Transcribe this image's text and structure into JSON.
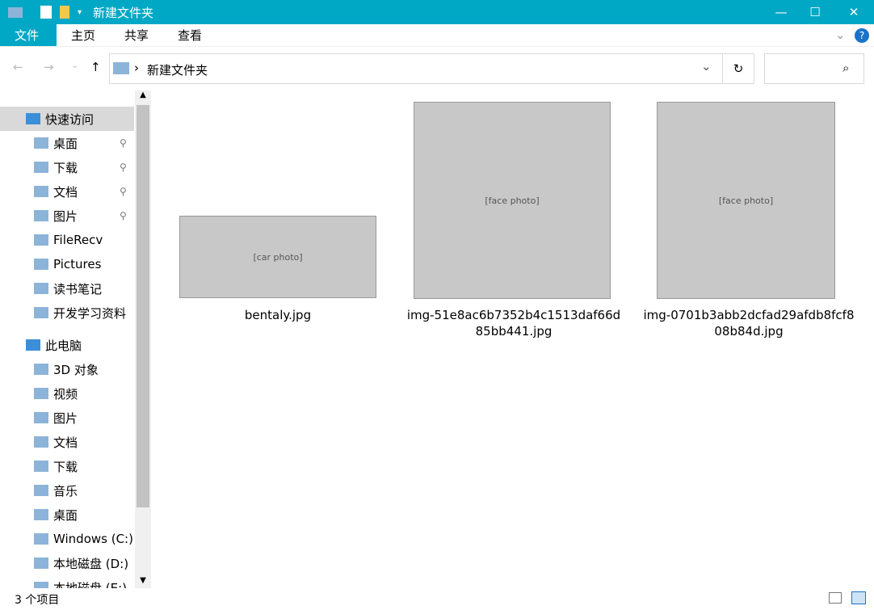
{
  "window": {
    "title": "新建文件夹",
    "minimize": "—",
    "maximize": "☐",
    "close": "✕"
  },
  "ribbon": {
    "tabs": [
      "文件",
      "主页",
      "共享",
      "查看"
    ],
    "help": "?"
  },
  "address": {
    "path": "新建文件夹",
    "sep": "›",
    "refresh": "↻"
  },
  "sidebar": [
    {
      "label": "快速访问",
      "indent": 0,
      "sel": true
    },
    {
      "label": "桌面",
      "indent": 1,
      "pin": true
    },
    {
      "label": "下载",
      "indent": 1,
      "pin": true
    },
    {
      "label": "文档",
      "indent": 1,
      "pin": true
    },
    {
      "label": "图片",
      "indent": 1,
      "pin": true
    },
    {
      "label": "FileRecv",
      "indent": 1
    },
    {
      "label": "Pictures",
      "indent": 1
    },
    {
      "label": "读书笔记",
      "indent": 1
    },
    {
      "label": "开发学习资料",
      "indent": 1
    },
    {
      "label": "此电脑",
      "indent": 0,
      "gap": true
    },
    {
      "label": "3D 对象",
      "indent": 1
    },
    {
      "label": "视频",
      "indent": 1
    },
    {
      "label": "图片",
      "indent": 1
    },
    {
      "label": "文档",
      "indent": 1
    },
    {
      "label": "下载",
      "indent": 1
    },
    {
      "label": "音乐",
      "indent": 1
    },
    {
      "label": "桌面",
      "indent": 1
    },
    {
      "label": "Windows (C:)",
      "indent": 1
    },
    {
      "label": "本地磁盘 (D:)",
      "indent": 1
    },
    {
      "label": "本地磁盘 (E:)",
      "indent": 1
    }
  ],
  "files": [
    {
      "name1": "bentaly.jpg",
      "name2": ""
    },
    {
      "name1": "img-51e8ac6b7352b4c1513daf66d",
      "name2": "85bb441.jpg"
    },
    {
      "name1": "img-0701b3abb2dcfad29afdb8fcf8",
      "name2": "08b84d.jpg"
    }
  ],
  "status": {
    "count": "3 个项目"
  }
}
